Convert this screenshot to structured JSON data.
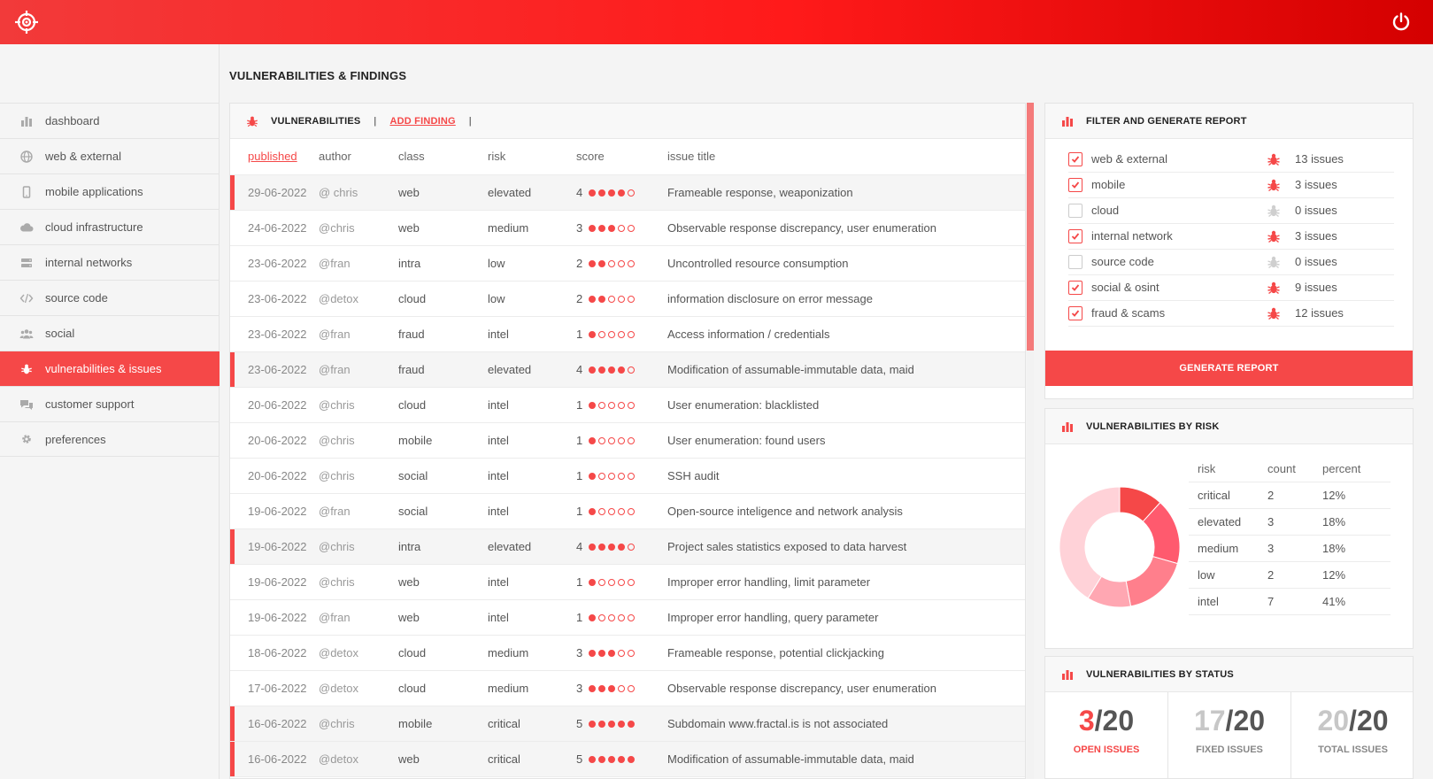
{
  "header": {
    "logo_icon": "crosshair-target-icon",
    "power_icon": "power-icon"
  },
  "colors": {
    "accent": "#f54848",
    "topbar": "#ff1a1a",
    "donut": [
      "#f54848",
      "#ff5a6e",
      "#ff7f8c",
      "#ffa7b2",
      "#ffd2d8"
    ]
  },
  "sidebar": {
    "items": [
      {
        "label": "dashboard",
        "icon": "bar-chart-icon",
        "active": false
      },
      {
        "label": "web & external",
        "icon": "globe-icon",
        "active": false
      },
      {
        "label": "mobile applications",
        "icon": "mobile-icon",
        "active": false
      },
      {
        "label": "cloud infrastructure",
        "icon": "cloud-icon",
        "active": false
      },
      {
        "label": "internal networks",
        "icon": "server-icon",
        "active": false
      },
      {
        "label": "source code",
        "icon": "code-icon",
        "active": false
      },
      {
        "label": "social",
        "icon": "users-icon",
        "active": false
      },
      {
        "label": "vulnerabilities & issues",
        "icon": "bug-icon",
        "active": true
      },
      {
        "label": "customer support",
        "icon": "chat-icon",
        "active": false
      },
      {
        "label": "preferences",
        "icon": "gear-icon",
        "active": false
      }
    ]
  },
  "page": {
    "title": "VULNERABILITIES & FINDINGS"
  },
  "vulnerabilities": {
    "heading": "VULNERABILITIES",
    "separator": "|",
    "add_label": "ADD FINDING",
    "columns": [
      "published",
      "author",
      "class",
      "risk",
      "score",
      "issue title"
    ],
    "rows": [
      {
        "date": "29-06-2022",
        "author": "@ chris",
        "class": "web",
        "risk": " elevated",
        "score": 4,
        "title": "Frameable response, weaponization",
        "highlight": true
      },
      {
        "date": "24-06-2022",
        "author": "@chris",
        "class": "web",
        "risk": "medium",
        "score": 3,
        "title": "Observable response discrepancy, user enumeration",
        "highlight": false
      },
      {
        "date": "23-06-2022",
        "author": "@fran",
        "class": "intra",
        "risk": "low",
        "score": 2,
        "title": "Uncontrolled resource consumption",
        "highlight": false
      },
      {
        "date": "23-06-2022",
        "author": "@detox",
        "class": "cloud",
        "risk": "low",
        "score": 2,
        "title": "information disclosure on error message",
        "highlight": false
      },
      {
        "date": "23-06-2022",
        "author": "@fran",
        "class": "fraud",
        "risk": "intel",
        "score": 1,
        "title": "Access information / credentials",
        "highlight": false
      },
      {
        "date": "23-06-2022",
        "author": "@fran",
        "class": "fraud",
        "risk": "elevated",
        "score": 4,
        "title": "Modification of assumable-immutable data, maid",
        "highlight": true
      },
      {
        "date": "20-06-2022",
        "author": "@chris",
        "class": "cloud",
        "risk": "intel",
        "score": 1,
        "title": "User enumeration: blacklisted",
        "highlight": false
      },
      {
        "date": "20-06-2022",
        "author": "@chris",
        "class": "mobile",
        "risk": "intel",
        "score": 1,
        "title": "User enumeration: found users",
        "highlight": false
      },
      {
        "date": "20-06-2022",
        "author": "@chris",
        "class": "social",
        "risk": "intel",
        "score": 1,
        "title": "SSH audit",
        "highlight": false
      },
      {
        "date": "19-06-2022",
        "author": "@fran",
        "class": "social",
        "risk": "intel",
        "score": 1,
        "title": "Open-source inteligence and network analysis",
        "highlight": false
      },
      {
        "date": "19-06-2022",
        "author": "@chris",
        "class": "intra",
        "risk": "elevated",
        "score": 4,
        "title": "Project sales statistics exposed to data harvest",
        "highlight": true
      },
      {
        "date": "19-06-2022",
        "author": "@chris",
        "class": "web",
        "risk": "intel",
        "score": 1,
        "title": "Improper error handling, limit parameter",
        "highlight": false
      },
      {
        "date": "19-06-2022",
        "author": "@fran",
        "class": "web",
        "risk": "intel",
        "score": 1,
        "title": "Improper error handling, query parameter",
        "highlight": false
      },
      {
        "date": "18-06-2022",
        "author": "@detox",
        "class": "cloud",
        "risk": "medium",
        "score": 3,
        "title": "Frameable response, potential clickjacking",
        "highlight": false
      },
      {
        "date": "17-06-2022",
        "author": "@detox",
        "class": "cloud",
        "risk": "medium",
        "score": 3,
        "title": "Observable response discrepancy, user enumeration",
        "highlight": false
      },
      {
        "date": "16-06-2022",
        "author": "@chris",
        "class": "mobile",
        "risk": "critical",
        "score": 5,
        "title": "Subdomain www.fractal.is is not associated",
        "highlight": true
      },
      {
        "date": "16-06-2022",
        "author": "@detox",
        "class": "web",
        "risk": "critical",
        "score": 5,
        "title": "Modification of assumable-immutable data, maid",
        "highlight": true
      }
    ]
  },
  "filter": {
    "heading": "FILTER AND GENERATE REPORT",
    "items": [
      {
        "label": "web & external",
        "checked": true,
        "issues": "13 issues"
      },
      {
        "label": "mobile",
        "checked": true,
        "issues": "3 issues"
      },
      {
        "label": "cloud",
        "checked": false,
        "issues": "0 issues"
      },
      {
        "label": "internal network",
        "checked": true,
        "issues": "3 issues"
      },
      {
        "label": "source code",
        "checked": false,
        "issues": "0 issues"
      },
      {
        "label": "social & osint",
        "checked": true,
        "issues": "9 issues"
      },
      {
        "label": "fraud & scams",
        "checked": true,
        "issues": "12 issues"
      }
    ],
    "button_label": "GENERATE REPORT"
  },
  "risk": {
    "heading": "VULNERABILITIES BY RISK",
    "columns": [
      "risk",
      "count",
      "percent"
    ],
    "rows": [
      {
        "risk": "critical",
        "count": "2",
        "percent": "12%"
      },
      {
        "risk": "elevated",
        "count": "3",
        "percent": "18%"
      },
      {
        "risk": "medium",
        "count": "3",
        "percent": "18%"
      },
      {
        "risk": "low",
        "count": "2",
        "percent": "12%"
      },
      {
        "risk": "intel",
        "count": "7",
        "percent": "41%"
      }
    ]
  },
  "status": {
    "heading": "VULNERABILITIES BY STATUS",
    "items": [
      {
        "num": "3",
        "den": "/20",
        "label": "OPEN ISSUES"
      },
      {
        "num": "17",
        "den": "/20",
        "label": "FIXED ISSUES"
      },
      {
        "num": "20",
        "den": "/20",
        "label": "TOTAL ISSUES"
      }
    ]
  }
}
